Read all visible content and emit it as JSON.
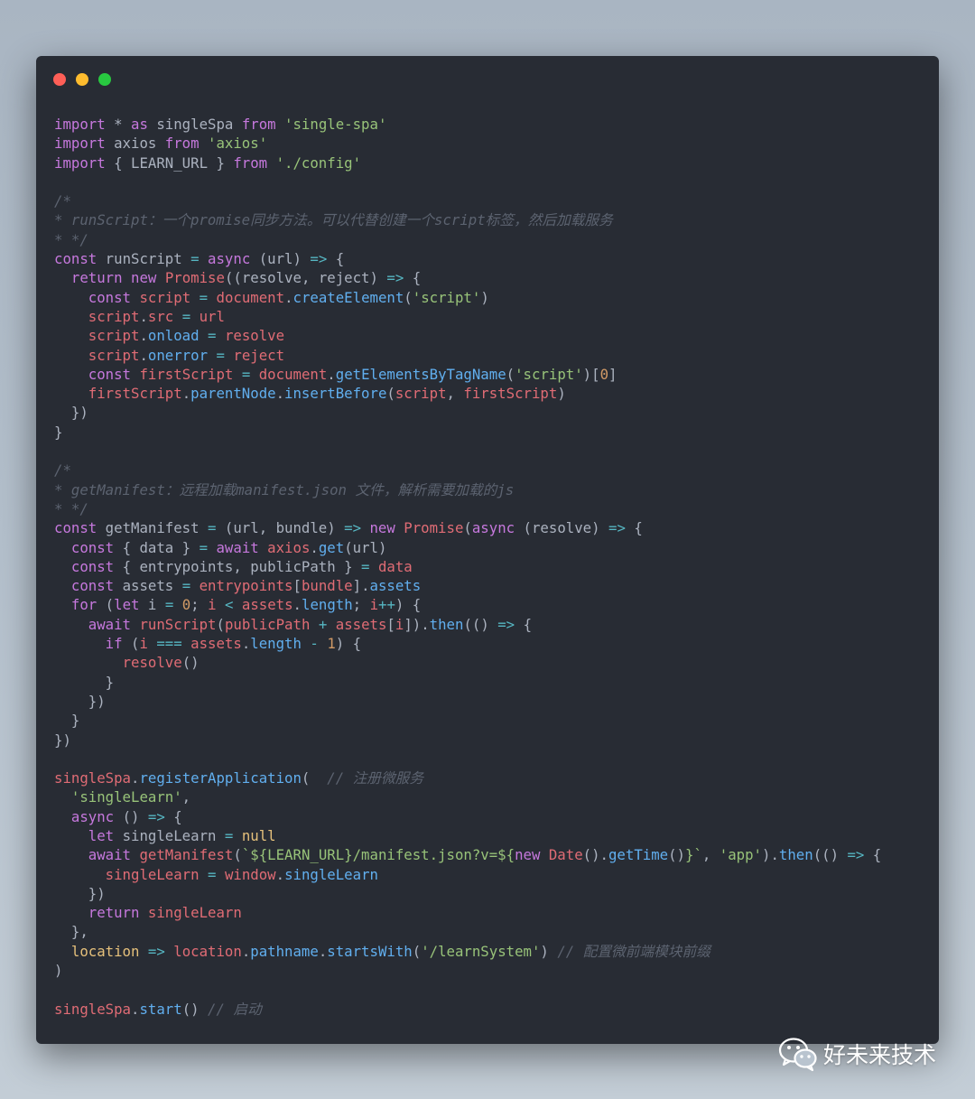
{
  "window": {
    "controls": [
      "close",
      "minimize",
      "zoom"
    ]
  },
  "code_lines": [
    [
      [
        "kw",
        "import"
      ],
      [
        "p",
        " * "
      ],
      [
        "kw",
        "as"
      ],
      [
        "p",
        " singleSpa "
      ],
      [
        "kw",
        "from"
      ],
      [
        "p",
        " "
      ],
      [
        "str",
        "'single-spa'"
      ]
    ],
    [
      [
        "kw",
        "import"
      ],
      [
        "p",
        " axios "
      ],
      [
        "kw",
        "from"
      ],
      [
        "p",
        " "
      ],
      [
        "str",
        "'axios'"
      ]
    ],
    [
      [
        "kw",
        "import"
      ],
      [
        "p",
        " { LEARN_URL } "
      ],
      [
        "kw",
        "from"
      ],
      [
        "p",
        " "
      ],
      [
        "str",
        "'./config'"
      ]
    ],
    [],
    [
      [
        "com",
        "/*"
      ]
    ],
    [
      [
        "com",
        "* runScript：一个promise同步方法。可以代替创建一个script标签，然后加载服务"
      ]
    ],
    [
      [
        "com",
        "* */"
      ]
    ],
    [
      [
        "kw",
        "const"
      ],
      [
        "p",
        " runScript "
      ],
      [
        "op",
        "="
      ],
      [
        "p",
        " "
      ],
      [
        "kw",
        "async"
      ],
      [
        "p",
        " (url) "
      ],
      [
        "op",
        "=>"
      ],
      [
        "p",
        " {"
      ]
    ],
    [
      [
        "p",
        "  "
      ],
      [
        "kw",
        "return"
      ],
      [
        "p",
        " "
      ],
      [
        "kw",
        "new"
      ],
      [
        "p",
        " "
      ],
      [
        "var",
        "Promise"
      ],
      [
        "p",
        "((resolve, reject) "
      ],
      [
        "op",
        "=>"
      ],
      [
        "p",
        " {"
      ]
    ],
    [
      [
        "p",
        "    "
      ],
      [
        "kw",
        "const"
      ],
      [
        "p",
        " "
      ],
      [
        "var",
        "script"
      ],
      [
        "p",
        " "
      ],
      [
        "op",
        "="
      ],
      [
        "p",
        " "
      ],
      [
        "var",
        "document"
      ],
      [
        "p",
        "."
      ],
      [
        "fn",
        "createElement"
      ],
      [
        "p",
        "("
      ],
      [
        "str",
        "'script'"
      ],
      [
        "p",
        ")"
      ]
    ],
    [
      [
        "p",
        "    "
      ],
      [
        "var",
        "script"
      ],
      [
        "p",
        "."
      ],
      [
        "var",
        "src"
      ],
      [
        "p",
        " "
      ],
      [
        "op",
        "="
      ],
      [
        "p",
        " "
      ],
      [
        "var",
        "url"
      ]
    ],
    [
      [
        "p",
        "    "
      ],
      [
        "var",
        "script"
      ],
      [
        "p",
        "."
      ],
      [
        "fn",
        "onload"
      ],
      [
        "p",
        " "
      ],
      [
        "op",
        "="
      ],
      [
        "p",
        " "
      ],
      [
        "var",
        "resolve"
      ]
    ],
    [
      [
        "p",
        "    "
      ],
      [
        "var",
        "script"
      ],
      [
        "p",
        "."
      ],
      [
        "fn",
        "onerror"
      ],
      [
        "p",
        " "
      ],
      [
        "op",
        "="
      ],
      [
        "p",
        " "
      ],
      [
        "var",
        "reject"
      ]
    ],
    [
      [
        "p",
        "    "
      ],
      [
        "kw",
        "const"
      ],
      [
        "p",
        " "
      ],
      [
        "var",
        "firstScript"
      ],
      [
        "p",
        " "
      ],
      [
        "op",
        "="
      ],
      [
        "p",
        " "
      ],
      [
        "var",
        "document"
      ],
      [
        "p",
        "."
      ],
      [
        "fn",
        "getElementsByTagName"
      ],
      [
        "p",
        "("
      ],
      [
        "str",
        "'script'"
      ],
      [
        "p",
        ")["
      ],
      [
        "num",
        "0"
      ],
      [
        "p",
        "]"
      ]
    ],
    [
      [
        "p",
        "    "
      ],
      [
        "var",
        "firstScript"
      ],
      [
        "p",
        "."
      ],
      [
        "fn",
        "parentNode"
      ],
      [
        "p",
        "."
      ],
      [
        "fn",
        "insertBefore"
      ],
      [
        "p",
        "("
      ],
      [
        "var",
        "script"
      ],
      [
        "p",
        ", "
      ],
      [
        "var",
        "firstScript"
      ],
      [
        "p",
        ")"
      ]
    ],
    [
      [
        "p",
        "  })"
      ]
    ],
    [
      [
        "p",
        "}"
      ]
    ],
    [],
    [
      [
        "com",
        "/*"
      ]
    ],
    [
      [
        "com",
        "* getManifest：远程加载manifest.json 文件，解析需要加载的js"
      ]
    ],
    [
      [
        "com",
        "* */"
      ]
    ],
    [
      [
        "kw",
        "const"
      ],
      [
        "p",
        " getManifest "
      ],
      [
        "op",
        "="
      ],
      [
        "p",
        " (url, bundle) "
      ],
      [
        "op",
        "=>"
      ],
      [
        "p",
        " "
      ],
      [
        "kw",
        "new"
      ],
      [
        "p",
        " "
      ],
      [
        "var",
        "Promise"
      ],
      [
        "p",
        "("
      ],
      [
        "kw",
        "async"
      ],
      [
        "p",
        " (resolve) "
      ],
      [
        "op",
        "=>"
      ],
      [
        "p",
        " {"
      ]
    ],
    [
      [
        "p",
        "  "
      ],
      [
        "kw",
        "const"
      ],
      [
        "p",
        " { data } "
      ],
      [
        "op",
        "="
      ],
      [
        "p",
        " "
      ],
      [
        "kw",
        "await"
      ],
      [
        "p",
        " "
      ],
      [
        "var",
        "axios"
      ],
      [
        "p",
        "."
      ],
      [
        "fn",
        "get"
      ],
      [
        "p",
        "(url)"
      ]
    ],
    [
      [
        "p",
        "  "
      ],
      [
        "kw",
        "const"
      ],
      [
        "p",
        " { entrypoints, publicPath } "
      ],
      [
        "op",
        "="
      ],
      [
        "p",
        " "
      ],
      [
        "var",
        "data"
      ]
    ],
    [
      [
        "p",
        "  "
      ],
      [
        "kw",
        "const"
      ],
      [
        "p",
        " assets "
      ],
      [
        "op",
        "="
      ],
      [
        "p",
        " "
      ],
      [
        "var",
        "entrypoints"
      ],
      [
        "p",
        "["
      ],
      [
        "var",
        "bundle"
      ],
      [
        "p",
        "]."
      ],
      [
        "fn",
        "assets"
      ]
    ],
    [
      [
        "p",
        "  "
      ],
      [
        "kw",
        "for"
      ],
      [
        "p",
        " ("
      ],
      [
        "kw",
        "let"
      ],
      [
        "p",
        " i "
      ],
      [
        "op",
        "="
      ],
      [
        "p",
        " "
      ],
      [
        "num",
        "0"
      ],
      [
        "p",
        "; "
      ],
      [
        "var",
        "i"
      ],
      [
        "p",
        " "
      ],
      [
        "op",
        "<"
      ],
      [
        "p",
        " "
      ],
      [
        "var",
        "assets"
      ],
      [
        "p",
        "."
      ],
      [
        "fn",
        "length"
      ],
      [
        "p",
        "; "
      ],
      [
        "var",
        "i"
      ],
      [
        "op",
        "++"
      ],
      [
        "p",
        ") {"
      ]
    ],
    [
      [
        "p",
        "    "
      ],
      [
        "kw",
        "await"
      ],
      [
        "p",
        " "
      ],
      [
        "var",
        "runScript"
      ],
      [
        "p",
        "("
      ],
      [
        "var",
        "publicPath"
      ],
      [
        "p",
        " "
      ],
      [
        "op",
        "+"
      ],
      [
        "p",
        " "
      ],
      [
        "var",
        "assets"
      ],
      [
        "p",
        "["
      ],
      [
        "var",
        "i"
      ],
      [
        "p",
        "])."
      ],
      [
        "fn",
        "then"
      ],
      [
        "p",
        "(() "
      ],
      [
        "op",
        "=>"
      ],
      [
        "p",
        " {"
      ]
    ],
    [
      [
        "p",
        "      "
      ],
      [
        "kw",
        "if"
      ],
      [
        "p",
        " ("
      ],
      [
        "var",
        "i"
      ],
      [
        "p",
        " "
      ],
      [
        "op",
        "==="
      ],
      [
        "p",
        " "
      ],
      [
        "var",
        "assets"
      ],
      [
        "p",
        "."
      ],
      [
        "fn",
        "length"
      ],
      [
        "p",
        " "
      ],
      [
        "op",
        "-"
      ],
      [
        "p",
        " "
      ],
      [
        "num",
        "1"
      ],
      [
        "p",
        ") {"
      ]
    ],
    [
      [
        "p",
        "        "
      ],
      [
        "var",
        "resolve"
      ],
      [
        "p",
        "()"
      ]
    ],
    [
      [
        "p",
        "      }"
      ]
    ],
    [
      [
        "p",
        "    })"
      ]
    ],
    [
      [
        "p",
        "  }"
      ]
    ],
    [
      [
        "p",
        "})"
      ]
    ],
    [],
    [
      [
        "var",
        "singleSpa"
      ],
      [
        "p",
        "."
      ],
      [
        "fn",
        "registerApplication"
      ],
      [
        "p",
        "(  "
      ],
      [
        "com",
        "// 注册微服务"
      ]
    ],
    [
      [
        "p",
        "  "
      ],
      [
        "str",
        "'singleLearn'"
      ],
      [
        "p",
        ","
      ]
    ],
    [
      [
        "p",
        "  "
      ],
      [
        "kw",
        "async"
      ],
      [
        "p",
        " () "
      ],
      [
        "op",
        "=>"
      ],
      [
        "p",
        " {"
      ]
    ],
    [
      [
        "p",
        "    "
      ],
      [
        "kw",
        "let"
      ],
      [
        "p",
        " singleLearn "
      ],
      [
        "op",
        "="
      ],
      [
        "p",
        " "
      ],
      [
        "cls",
        "null"
      ]
    ],
    [
      [
        "p",
        "    "
      ],
      [
        "kw",
        "await"
      ],
      [
        "p",
        " "
      ],
      [
        "var",
        "getManifest"
      ],
      [
        "p",
        "("
      ],
      [
        "str",
        "`${LEARN_URL}/manifest.json?v=${"
      ],
      [
        "kw",
        "new"
      ],
      [
        "p",
        " "
      ],
      [
        "var",
        "Date"
      ],
      [
        "p",
        "()."
      ],
      [
        "fn",
        "getTime"
      ],
      [
        "p",
        "()"
      ],
      [
        "str",
        "}`"
      ],
      [
        "p",
        ", "
      ],
      [
        "str",
        "'app'"
      ],
      [
        "p",
        ")."
      ],
      [
        "fn",
        "then"
      ],
      [
        "p",
        "(() "
      ],
      [
        "op",
        "=>"
      ],
      [
        "p",
        " {"
      ]
    ],
    [
      [
        "p",
        "      "
      ],
      [
        "var",
        "singleLearn"
      ],
      [
        "p",
        " "
      ],
      [
        "op",
        "="
      ],
      [
        "p",
        " "
      ],
      [
        "var",
        "window"
      ],
      [
        "p",
        "."
      ],
      [
        "fn",
        "singleLearn"
      ]
    ],
    [
      [
        "p",
        "    })"
      ]
    ],
    [
      [
        "p",
        "    "
      ],
      [
        "kw",
        "return"
      ],
      [
        "p",
        " "
      ],
      [
        "var",
        "singleLearn"
      ]
    ],
    [
      [
        "p",
        "  },"
      ]
    ],
    [
      [
        "p",
        "  "
      ],
      [
        "cls",
        "location"
      ],
      [
        "p",
        " "
      ],
      [
        "op",
        "=>"
      ],
      [
        "p",
        " "
      ],
      [
        "var",
        "location"
      ],
      [
        "p",
        "."
      ],
      [
        "fn",
        "pathname"
      ],
      [
        "p",
        "."
      ],
      [
        "fn",
        "startsWith"
      ],
      [
        "p",
        "("
      ],
      [
        "str",
        "'/learnSystem'"
      ],
      [
        "p",
        ") "
      ],
      [
        "com",
        "// 配置微前端模块前缀"
      ]
    ],
    [
      [
        "p",
        ")"
      ]
    ],
    [],
    [
      [
        "var",
        "singleSpa"
      ],
      [
        "p",
        "."
      ],
      [
        "fn",
        "start"
      ],
      [
        "p",
        "() "
      ],
      [
        "com",
        "// 启动"
      ]
    ]
  ],
  "watermark": {
    "icon": "wechat-icon",
    "text": "好未来技术"
  }
}
